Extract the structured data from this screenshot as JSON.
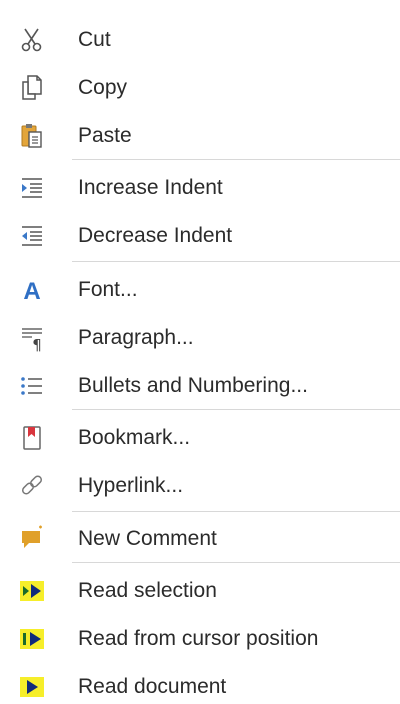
{
  "menu": {
    "groups": [
      {
        "items": [
          {
            "label": "Cut",
            "icon": "scissors-icon"
          },
          {
            "label": "Copy",
            "icon": "copy-icon"
          },
          {
            "label": "Paste",
            "icon": "clipboard-icon"
          }
        ]
      },
      {
        "items": [
          {
            "label": "Increase Indent",
            "icon": "increase-indent-icon"
          },
          {
            "label": "Decrease Indent",
            "icon": "decrease-indent-icon"
          }
        ]
      },
      {
        "items": [
          {
            "label": "Font...",
            "icon": "font-icon"
          },
          {
            "label": "Paragraph...",
            "icon": "paragraph-icon"
          },
          {
            "label": "Bullets and Numbering...",
            "icon": "bullet-list-icon"
          }
        ]
      },
      {
        "items": [
          {
            "label": "Bookmark...",
            "icon": "bookmark-icon"
          },
          {
            "label": "Hyperlink...",
            "icon": "link-icon"
          }
        ]
      },
      {
        "items": [
          {
            "label": "New Comment",
            "icon": "comment-icon"
          }
        ]
      },
      {
        "items": [
          {
            "label": "Read selection",
            "icon": "read-selection-icon"
          },
          {
            "label": "Read from cursor position",
            "icon": "read-from-cursor-icon"
          },
          {
            "label": "Read document",
            "icon": "read-document-icon"
          }
        ]
      }
    ]
  },
  "colors": {
    "text": "#2b2b2b",
    "separator": "#d8d8d8",
    "font_icon_blue": "#2f6fc4",
    "comment_orange": "#e0a02a",
    "read_yellow": "#f6ee2a",
    "bookmark_red": "#d9363e"
  }
}
